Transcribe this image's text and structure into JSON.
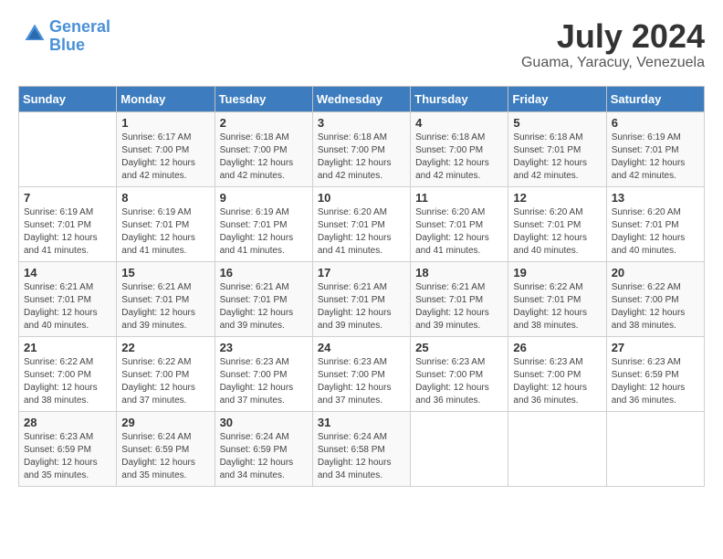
{
  "logo": {
    "line1": "General",
    "line2": "Blue"
  },
  "title": "July 2024",
  "location": "Guama, Yaracuy, Venezuela",
  "days_of_week": [
    "Sunday",
    "Monday",
    "Tuesday",
    "Wednesday",
    "Thursday",
    "Friday",
    "Saturday"
  ],
  "weeks": [
    [
      {
        "day": "",
        "content": ""
      },
      {
        "day": "1",
        "content": "Sunrise: 6:17 AM\nSunset: 7:00 PM\nDaylight: 12 hours\nand 42 minutes."
      },
      {
        "day": "2",
        "content": "Sunrise: 6:18 AM\nSunset: 7:00 PM\nDaylight: 12 hours\nand 42 minutes."
      },
      {
        "day": "3",
        "content": "Sunrise: 6:18 AM\nSunset: 7:00 PM\nDaylight: 12 hours\nand 42 minutes."
      },
      {
        "day": "4",
        "content": "Sunrise: 6:18 AM\nSunset: 7:00 PM\nDaylight: 12 hours\nand 42 minutes."
      },
      {
        "day": "5",
        "content": "Sunrise: 6:18 AM\nSunset: 7:01 PM\nDaylight: 12 hours\nand 42 minutes."
      },
      {
        "day": "6",
        "content": "Sunrise: 6:19 AM\nSunset: 7:01 PM\nDaylight: 12 hours\nand 42 minutes."
      }
    ],
    [
      {
        "day": "7",
        "content": "Sunrise: 6:19 AM\nSunset: 7:01 PM\nDaylight: 12 hours\nand 41 minutes."
      },
      {
        "day": "8",
        "content": "Sunrise: 6:19 AM\nSunset: 7:01 PM\nDaylight: 12 hours\nand 41 minutes."
      },
      {
        "day": "9",
        "content": "Sunrise: 6:19 AM\nSunset: 7:01 PM\nDaylight: 12 hours\nand 41 minutes."
      },
      {
        "day": "10",
        "content": "Sunrise: 6:20 AM\nSunset: 7:01 PM\nDaylight: 12 hours\nand 41 minutes."
      },
      {
        "day": "11",
        "content": "Sunrise: 6:20 AM\nSunset: 7:01 PM\nDaylight: 12 hours\nand 41 minutes."
      },
      {
        "day": "12",
        "content": "Sunrise: 6:20 AM\nSunset: 7:01 PM\nDaylight: 12 hours\nand 40 minutes."
      },
      {
        "day": "13",
        "content": "Sunrise: 6:20 AM\nSunset: 7:01 PM\nDaylight: 12 hours\nand 40 minutes."
      }
    ],
    [
      {
        "day": "14",
        "content": "Sunrise: 6:21 AM\nSunset: 7:01 PM\nDaylight: 12 hours\nand 40 minutes."
      },
      {
        "day": "15",
        "content": "Sunrise: 6:21 AM\nSunset: 7:01 PM\nDaylight: 12 hours\nand 39 minutes."
      },
      {
        "day": "16",
        "content": "Sunrise: 6:21 AM\nSunset: 7:01 PM\nDaylight: 12 hours\nand 39 minutes."
      },
      {
        "day": "17",
        "content": "Sunrise: 6:21 AM\nSunset: 7:01 PM\nDaylight: 12 hours\nand 39 minutes."
      },
      {
        "day": "18",
        "content": "Sunrise: 6:21 AM\nSunset: 7:01 PM\nDaylight: 12 hours\nand 39 minutes."
      },
      {
        "day": "19",
        "content": "Sunrise: 6:22 AM\nSunset: 7:01 PM\nDaylight: 12 hours\nand 38 minutes."
      },
      {
        "day": "20",
        "content": "Sunrise: 6:22 AM\nSunset: 7:00 PM\nDaylight: 12 hours\nand 38 minutes."
      }
    ],
    [
      {
        "day": "21",
        "content": "Sunrise: 6:22 AM\nSunset: 7:00 PM\nDaylight: 12 hours\nand 38 minutes."
      },
      {
        "day": "22",
        "content": "Sunrise: 6:22 AM\nSunset: 7:00 PM\nDaylight: 12 hours\nand 37 minutes."
      },
      {
        "day": "23",
        "content": "Sunrise: 6:23 AM\nSunset: 7:00 PM\nDaylight: 12 hours\nand 37 minutes."
      },
      {
        "day": "24",
        "content": "Sunrise: 6:23 AM\nSunset: 7:00 PM\nDaylight: 12 hours\nand 37 minutes."
      },
      {
        "day": "25",
        "content": "Sunrise: 6:23 AM\nSunset: 7:00 PM\nDaylight: 12 hours\nand 36 minutes."
      },
      {
        "day": "26",
        "content": "Sunrise: 6:23 AM\nSunset: 7:00 PM\nDaylight: 12 hours\nand 36 minutes."
      },
      {
        "day": "27",
        "content": "Sunrise: 6:23 AM\nSunset: 6:59 PM\nDaylight: 12 hours\nand 36 minutes."
      }
    ],
    [
      {
        "day": "28",
        "content": "Sunrise: 6:23 AM\nSunset: 6:59 PM\nDaylight: 12 hours\nand 35 minutes."
      },
      {
        "day": "29",
        "content": "Sunrise: 6:24 AM\nSunset: 6:59 PM\nDaylight: 12 hours\nand 35 minutes."
      },
      {
        "day": "30",
        "content": "Sunrise: 6:24 AM\nSunset: 6:59 PM\nDaylight: 12 hours\nand 34 minutes."
      },
      {
        "day": "31",
        "content": "Sunrise: 6:24 AM\nSunset: 6:58 PM\nDaylight: 12 hours\nand 34 minutes."
      },
      {
        "day": "",
        "content": ""
      },
      {
        "day": "",
        "content": ""
      },
      {
        "day": "",
        "content": ""
      }
    ]
  ]
}
